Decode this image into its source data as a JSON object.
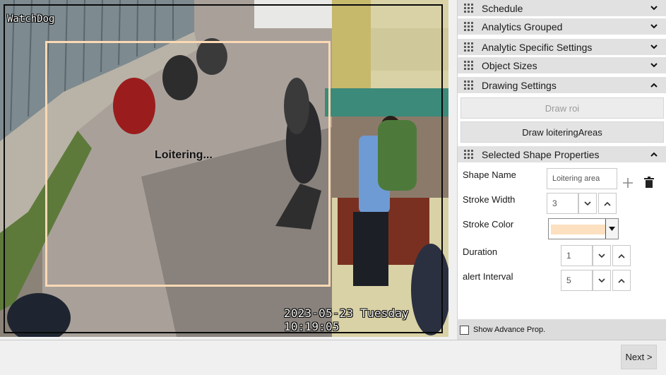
{
  "camera": {
    "name": "WatchDog",
    "timestamp": "2023-05-23 Tuesday 10:19:05",
    "roi_label": "Loitering...",
    "roi_color": "#fbd9b5"
  },
  "sections": {
    "schedule": "Schedule",
    "analytics_grouped": "Analytics Grouped",
    "analytic_specific": "Analytic Specific Settings",
    "object_sizes": "Object Sizes",
    "drawing_settings": "Drawing Settings",
    "selected_shape": "Selected Shape Properties"
  },
  "drawing": {
    "draw_roi": "Draw roi",
    "draw_loitering": "Draw loiteringAreas"
  },
  "shape": {
    "name_label": "Shape Name",
    "name_value": "Loitering area",
    "stroke_width_label": "Stroke Width",
    "stroke_width_value": "3",
    "stroke_color_label": "Stroke Color",
    "stroke_color_value": "#fde0c0",
    "duration_label": "Duration",
    "duration_value": "1",
    "alert_interval_label": "alert Interval",
    "alert_interval_value": "5"
  },
  "advanced": {
    "label": "Show Advance Prop."
  },
  "footer": {
    "next": "Next >"
  }
}
